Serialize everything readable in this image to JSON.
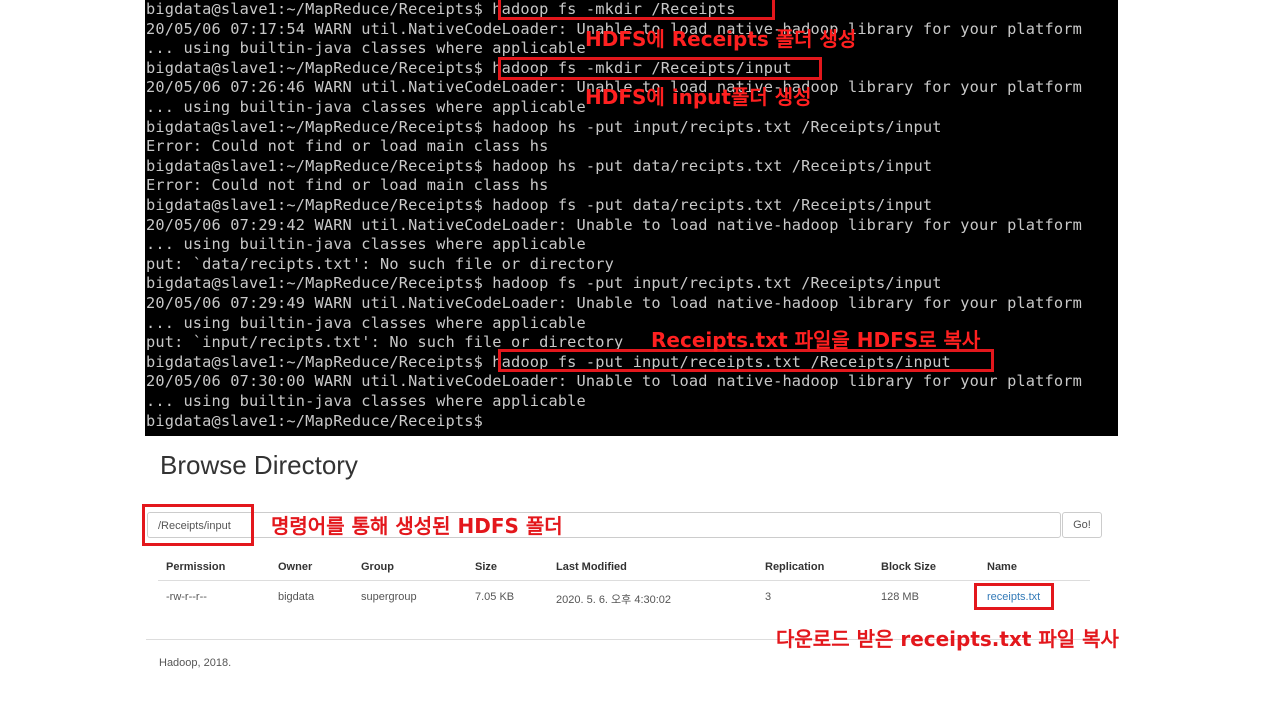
{
  "terminal": {
    "lines": [
      "bigdata@slave1:~/MapReduce/Receipts$ hadoop fs -mkdir /Receipts",
      "20/05/06 07:17:54 WARN util.NativeCodeLoader: Unable to load native-hadoop library for your platform",
      "... using builtin-java classes where applicable",
      "bigdata@slave1:~/MapReduce/Receipts$ hadoop fs -mkdir /Receipts/input",
      "20/05/06 07:26:46 WARN util.NativeCodeLoader: Unable to load native-hadoop library for your platform",
      "... using builtin-java classes where applicable",
      "bigdata@slave1:~/MapReduce/Receipts$ hadoop hs -put input/recipts.txt /Receipts/input",
      "Error: Could not find or load main class hs",
      "bigdata@slave1:~/MapReduce/Receipts$ hadoop hs -put data/recipts.txt /Receipts/input",
      "Error: Could not find or load main class hs",
      "bigdata@slave1:~/MapReduce/Receipts$ hadoop fs -put data/recipts.txt /Receipts/input",
      "20/05/06 07:29:42 WARN util.NativeCodeLoader: Unable to load native-hadoop library for your platform",
      "... using builtin-java classes where applicable",
      "put: `data/recipts.txt': No such file or directory",
      "bigdata@slave1:~/MapReduce/Receipts$ hadoop fs -put input/recipts.txt /Receipts/input",
      "20/05/06 07:29:49 WARN util.NativeCodeLoader: Unable to load native-hadoop library for your platform",
      "... using builtin-java classes where applicable",
      "put: `input/recipts.txt': No such file or directory",
      "bigdata@slave1:~/MapReduce/Receipts$ hadoop fs -put input/receipts.txt /Receipts/input",
      "20/05/06 07:30:00 WARN util.NativeCodeLoader: Unable to load native-hadoop library for your platform",
      "... using builtin-java classes where applicable",
      "bigdata@slave1:~/MapReduce/Receipts$"
    ],
    "annotations": {
      "mkdir_receipts": "HDFS에 Receipts 폴더 생성",
      "mkdir_input": "HDFS에 input폴더 생성",
      "put_receipts": "Receipts.txt 파일을 HDFS로 복사"
    }
  },
  "browse": {
    "title": "Browse Directory",
    "path_value": "/Receipts/input",
    "go_label": "Go!",
    "path_annotation": "명령어를 통해 생성된 HDFS 폴더",
    "headers": {
      "permission": "Permission",
      "owner": "Owner",
      "group": "Group",
      "size": "Size",
      "last_modified": "Last Modified",
      "replication": "Replication",
      "block_size": "Block Size",
      "name": "Name"
    },
    "row": {
      "permission": "-rw-r--r--",
      "owner": "bigdata",
      "group": "supergroup",
      "size": "7.05 KB",
      "last_modified": "2020. 5. 6. 오후 4:30:02",
      "replication": "3",
      "block_size": "128 MB",
      "name": "receipts.txt"
    },
    "file_annotation": "다운로드 받은 receipts.txt 파일 복사",
    "footer": "Hadoop, 2018."
  },
  "colors": {
    "terminal_bg": "#000000",
    "terminal_text": "#c8c8c8",
    "highlight": "#e3171c",
    "link": "#337ab7"
  }
}
